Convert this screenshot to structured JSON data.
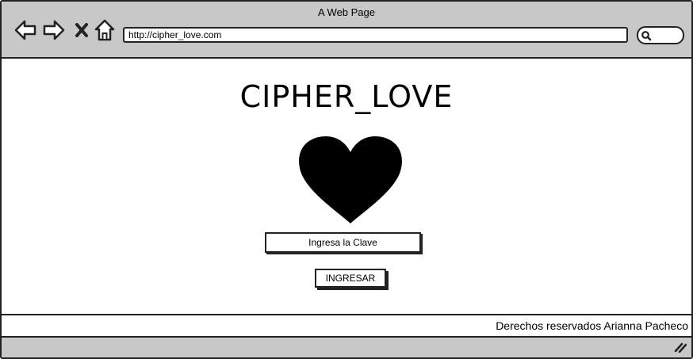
{
  "window": {
    "title": "A Web Page"
  },
  "toolbar": {
    "back_icon": "arrow-left-icon",
    "forward_icon": "arrow-right-icon",
    "stop_icon": "close-icon",
    "home_icon": "home-icon",
    "url": "http://cipher_love.com",
    "search_icon": "search-icon"
  },
  "page": {
    "title": "CIPHER_LOVE",
    "heart_icon": "heart-icon",
    "heart_color": "#000000",
    "key_field": {
      "value": "Ingresa la Clave"
    },
    "enter_button": {
      "label": "INGRESAR"
    }
  },
  "footer": {
    "text": "Derechos reservados Arianna Pacheco"
  },
  "statusbar": {
    "grip_icon": "resize-grip-icon"
  },
  "colors": {
    "chrome": "#c8c8c8",
    "border": "#222222",
    "background": "#ffffff"
  }
}
